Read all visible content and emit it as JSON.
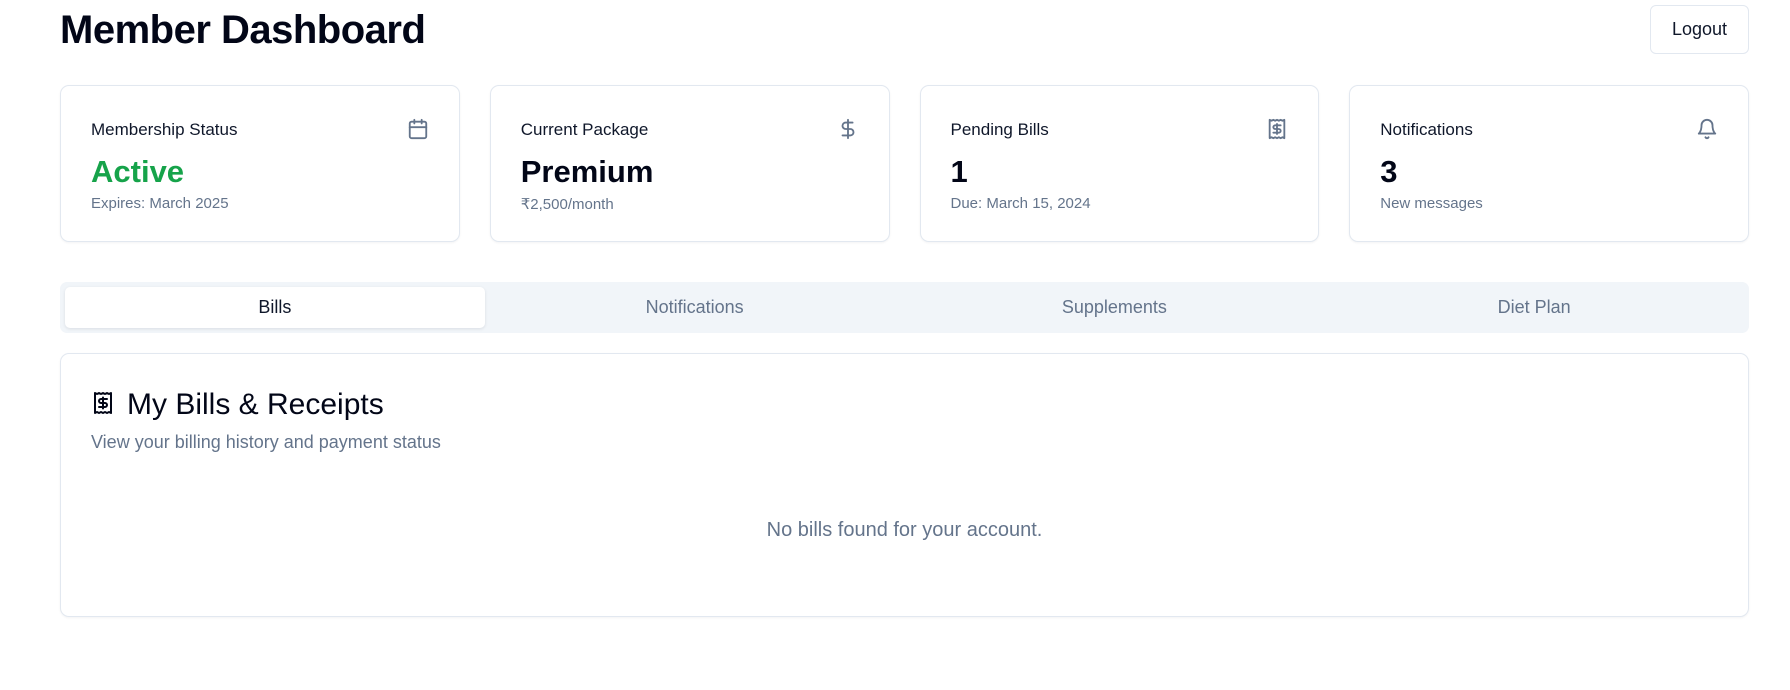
{
  "header": {
    "title": "Member Dashboard",
    "logout_label": "Logout"
  },
  "stats": [
    {
      "label": "Membership Status",
      "value": "Active",
      "sub": "Expires: March 2025",
      "icon": "calendar-icon",
      "value_color": "#16a34a"
    },
    {
      "label": "Current Package",
      "value": "Premium",
      "sub": "₹2,500/month",
      "icon": "dollar-sign-icon"
    },
    {
      "label": "Pending Bills",
      "value": "1",
      "sub": "Due: March 15, 2024",
      "icon": "receipt-icon"
    },
    {
      "label": "Notifications",
      "value": "3",
      "sub": "New messages",
      "icon": "bell-icon"
    }
  ],
  "tabs": [
    {
      "label": "Bills",
      "active": true
    },
    {
      "label": "Notifications",
      "active": false
    },
    {
      "label": "Supplements",
      "active": false
    },
    {
      "label": "Diet Plan",
      "active": false
    }
  ],
  "bills_panel": {
    "icon": "receipt-icon",
    "title": "My Bills & Receipts",
    "description": "View your billing history and payment status",
    "empty_message": "No bills found for your account."
  },
  "colors": {
    "accent_green": "#16a34a",
    "muted_text": "#64748b",
    "border": "#e2e8f0",
    "tab_bar_bg": "#f1f5f9"
  }
}
